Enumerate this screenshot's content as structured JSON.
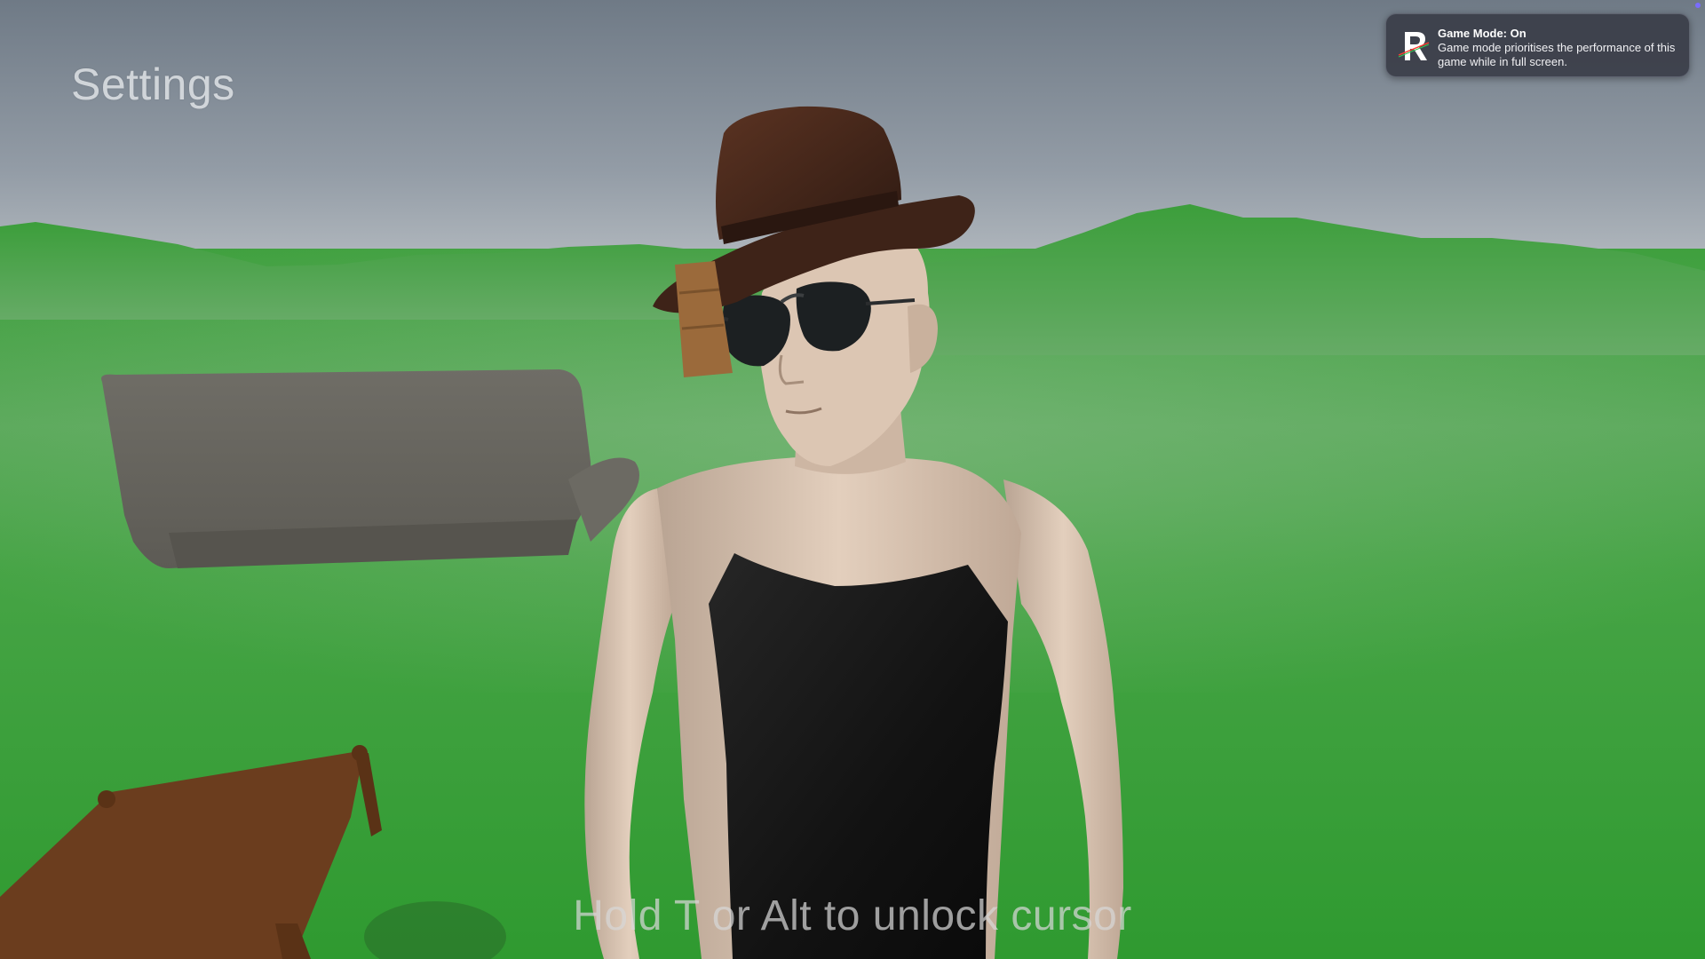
{
  "hud": {
    "settings_label": "Settings",
    "cursor_hint": "Hold T or Alt to unlock cursor"
  },
  "notification": {
    "title": "Game Mode: On",
    "body": "Game mode prioritises the performance of this game while in full screen.",
    "icon": "app-r-icon"
  },
  "scene": {
    "sky_color": "#8e98a3",
    "grass_color": "#3da43c",
    "skin_color": "#d9c3b0",
    "hat_color": "#4a2a1c",
    "shirt_color": "#1a1a1a",
    "sofa_color": "#737068",
    "table_color": "#6b3d1e"
  }
}
